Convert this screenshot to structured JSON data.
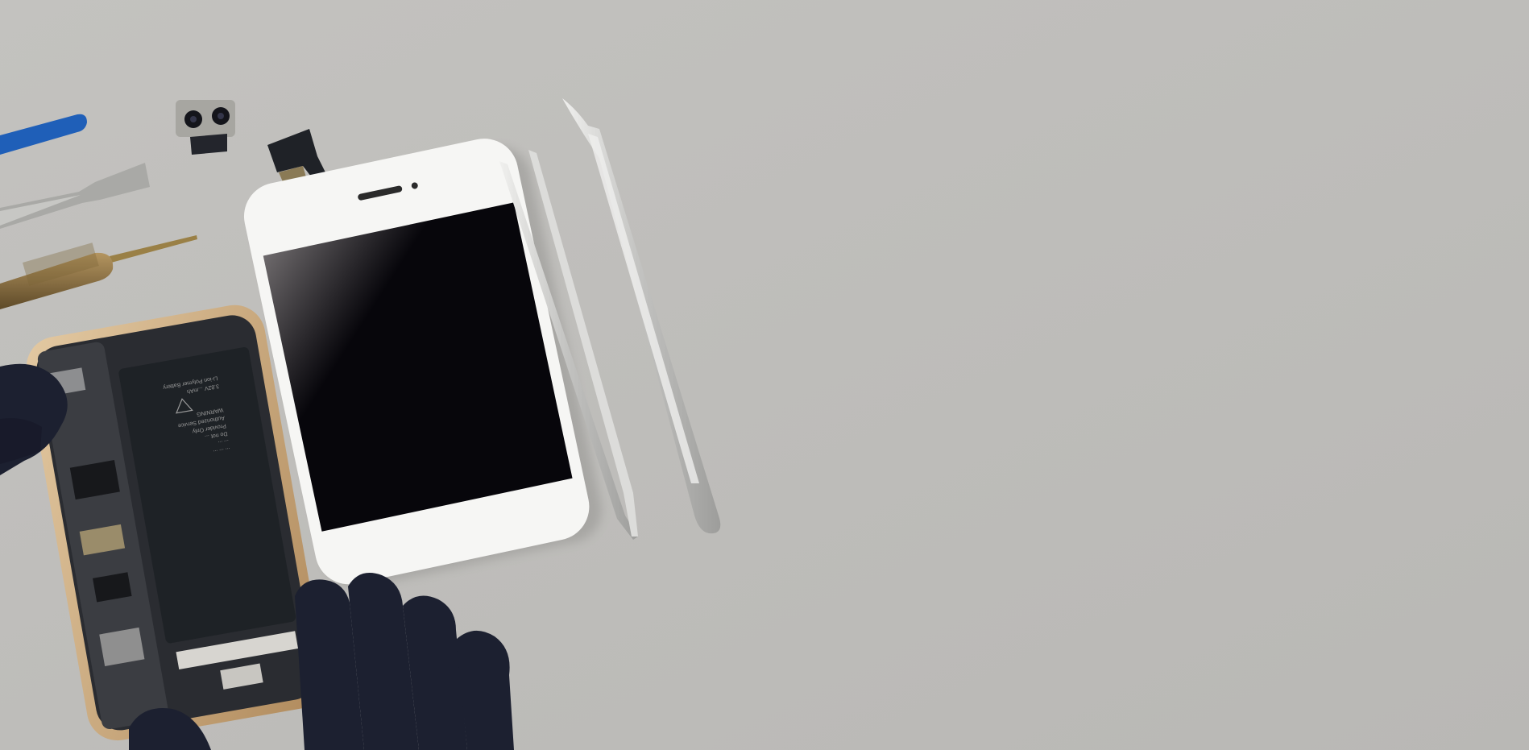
{
  "colors": {
    "background": "#b9b8b5",
    "background_light": "#c3c2bf",
    "phone_body": "#f6f6f4",
    "screen_dark": "#07060b",
    "screen_light": "#6e6a6c",
    "glove": "#1c2030",
    "gold_frame": "#c9a77d",
    "battery": "#1e2226",
    "tweezer": "#d4d4d2",
    "blue_tool": "#1f5fb8",
    "screwdriver_gold": "#8a6f3e"
  },
  "battery_label": {
    "lines": [
      "Li-ion Polymer Battery",
      "3.82V ...mAh",
      "WARNING",
      "Authorized Service",
      "Provider Only",
      "Do not ...",
      "... ...",
      "... ... ..."
    ]
  }
}
